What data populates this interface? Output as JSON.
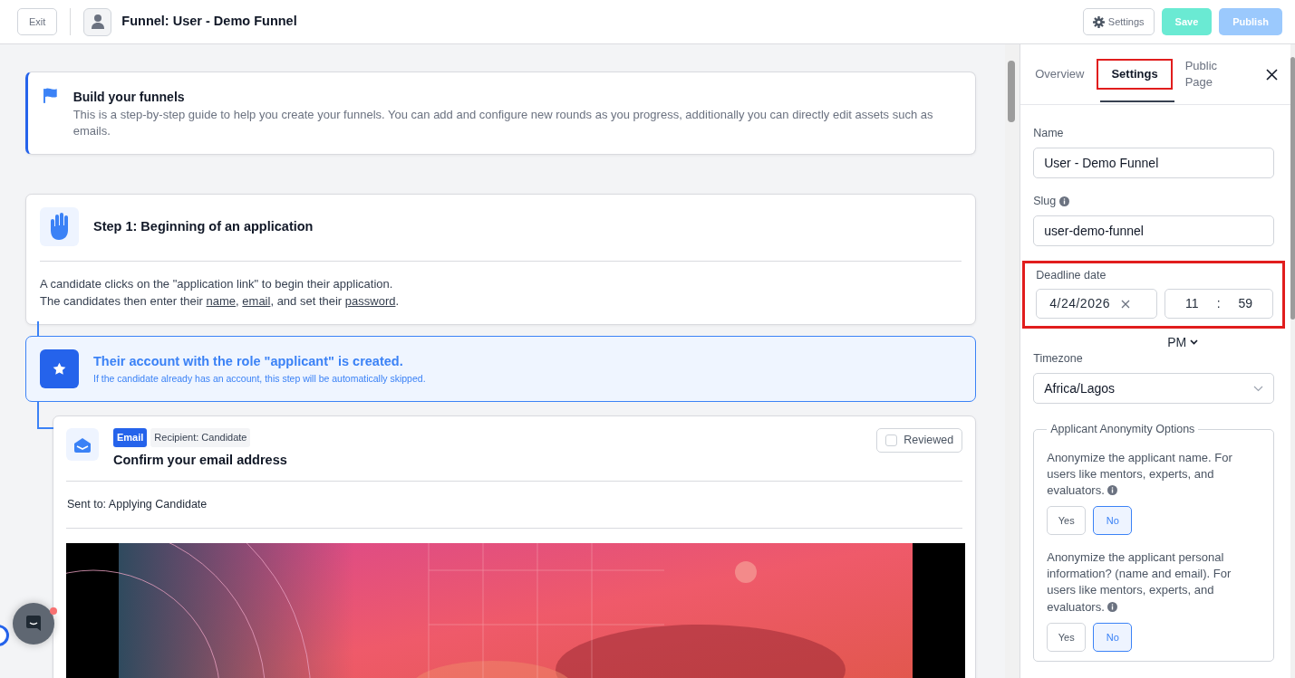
{
  "header": {
    "exit_button": "Exit",
    "title": "Funnel: User - Demo Funnel",
    "buttons": [
      {
        "label": "Settings",
        "kind": "settings",
        "disabled": false
      },
      {
        "label": "Save",
        "kind": "save",
        "disabled": true
      },
      {
        "label": "Publish",
        "kind": "publish",
        "disabled": true
      }
    ]
  },
  "guide": {
    "title": "Build your funnels",
    "text": "This is a step-by-step guide to help you create your funnels. You can add and configure new rounds as you progress, additionally you can directly edit assets such as emails."
  },
  "step": {
    "title": "Step 1: Beginning of an application",
    "lines": [
      [
        {
          "kind": "text",
          "text": "A candidate clicks on the \"application link\" to begin their application."
        }
      ],
      [
        {
          "kind": "text",
          "text": "The candidates then enter their "
        },
        {
          "kind": "link",
          "text": "name"
        },
        {
          "kind": "text",
          "text": ", "
        },
        {
          "kind": "link",
          "text": "email"
        },
        {
          "kind": "text",
          "text": ", and set their "
        },
        {
          "kind": "link",
          "text": "password"
        },
        {
          "kind": "text",
          "text": "."
        }
      ]
    ]
  },
  "account": {
    "title": "Their account with the role \"applicant\" is created.",
    "note": "If the candidate already has an account, this step will be automatically skipped."
  },
  "email": {
    "tags": [
      {
        "label": "Email",
        "kind": "type"
      },
      {
        "label": "Recipient: Candidate",
        "kind": "recipient"
      }
    ],
    "title": "Confirm your email address",
    "reviewed": {
      "label": "Reviewed",
      "checked": false
    },
    "sent_to": "Sent to: Applying Candidate"
  },
  "panel": {
    "tabs": [
      {
        "label": "Overview",
        "selected": false,
        "highlighted": false
      },
      {
        "label": "Settings",
        "selected": true,
        "highlighted": true
      },
      {
        "label": "Public Page",
        "selected": false,
        "highlighted": false
      }
    ],
    "name": {
      "label": "Name",
      "value": "User - Demo Funnel"
    },
    "slug": {
      "label": "Slug",
      "value": "user-demo-funnel"
    },
    "deadline": {
      "label": "Deadline date",
      "highlighted": true,
      "date": "4/24/2026",
      "hour": "11",
      "separator": ":",
      "minute": "59",
      "period": "PM"
    },
    "timezone": {
      "label": "Timezone",
      "value": "Africa/Lagos"
    },
    "anonymity": {
      "legend": "Applicant Anonymity Options",
      "questions": [
        {
          "text": "Anonymize the applicant name. For users like mentors, experts, and evaluators.",
          "options": [
            {
              "label": "Yes",
              "selected": false
            },
            {
              "label": "No",
              "selected": true
            }
          ]
        },
        {
          "text": "Anonymize the applicant personal information? (name and email). For users like mentors, experts, and evaluators.",
          "options": [
            {
              "label": "Yes",
              "selected": false
            },
            {
              "label": "No",
              "selected": true
            }
          ]
        }
      ]
    }
  },
  "chat": {
    "unread": true
  }
}
